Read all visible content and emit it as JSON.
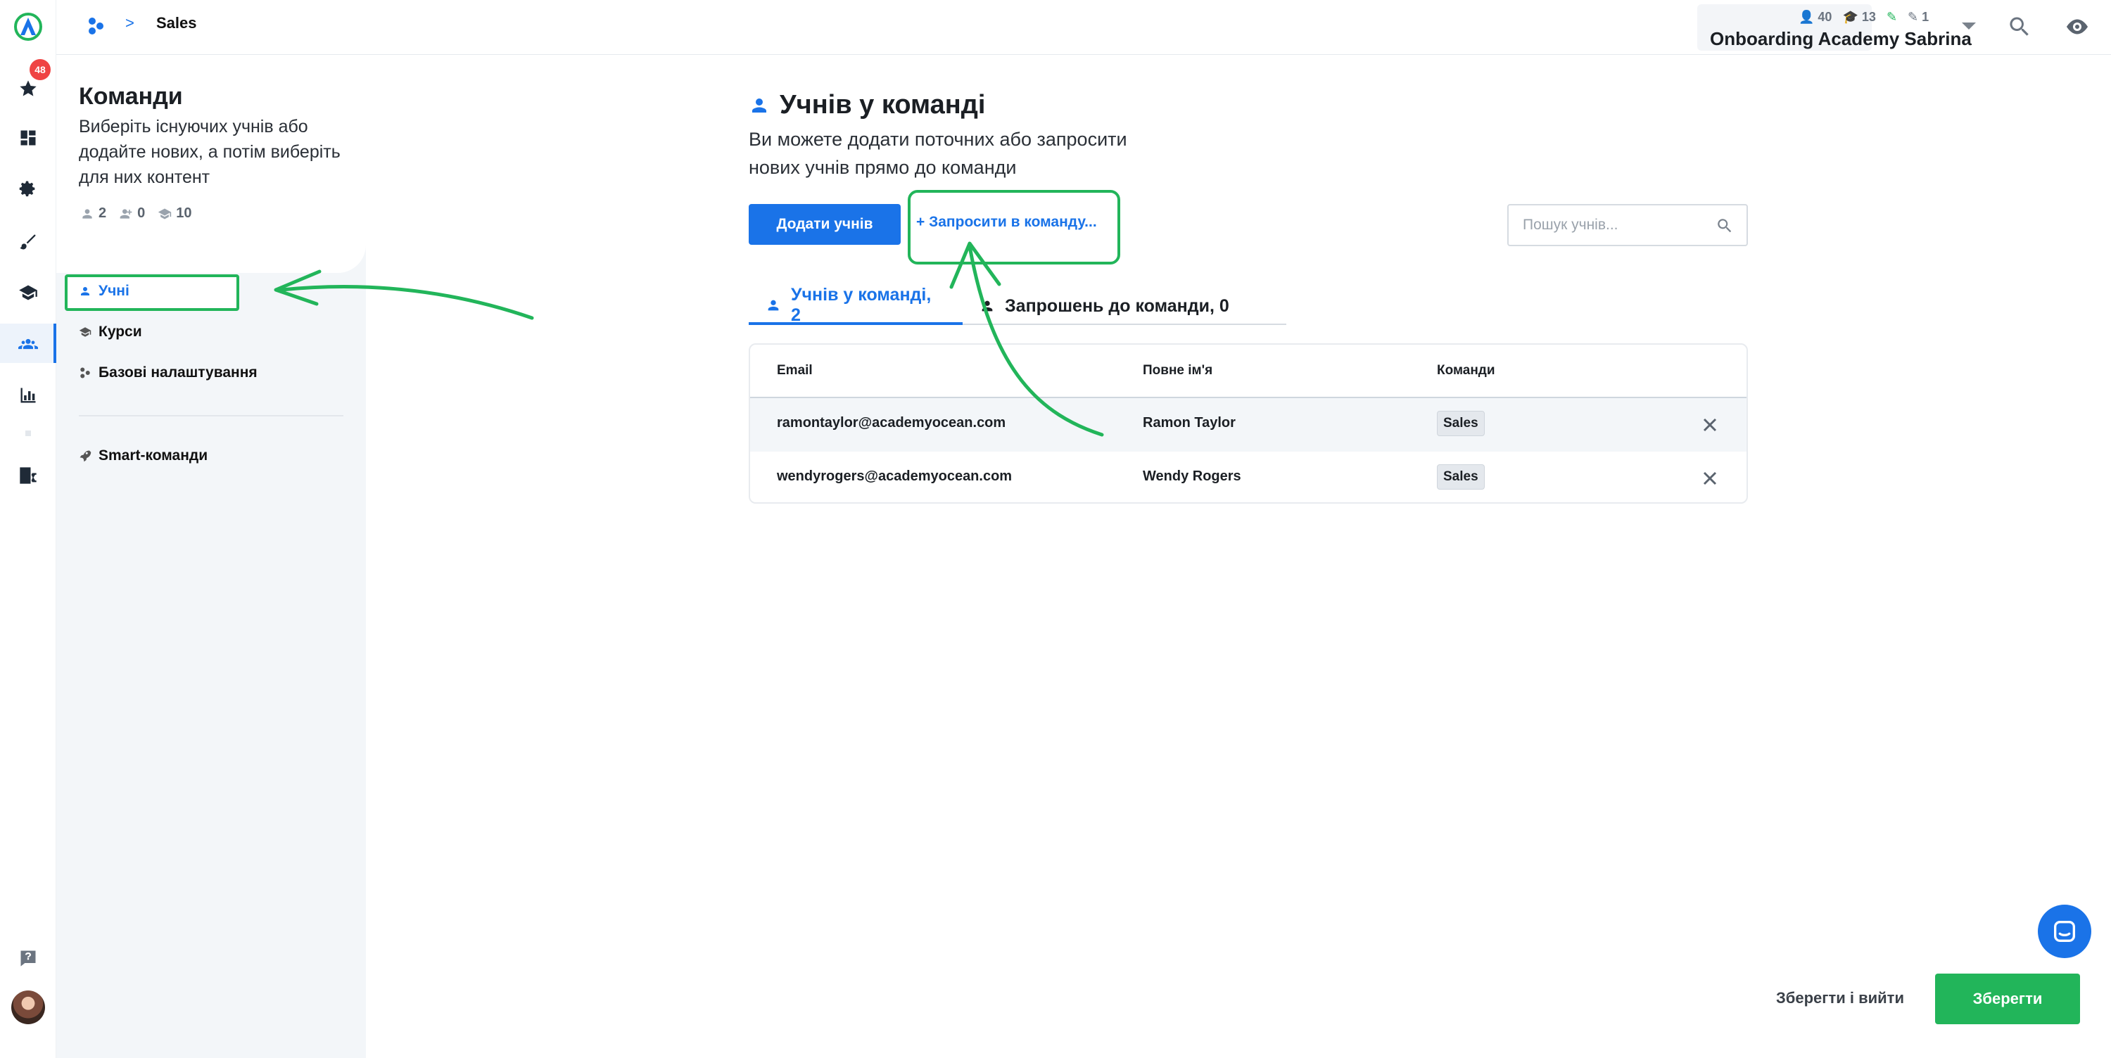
{
  "rail": {
    "badge_count": "48",
    "items": [
      "logo-icon",
      "star-icon",
      "dashboard-icon",
      "gear-icon",
      "brush-icon",
      "graduation-cap-icon",
      "team-icon",
      "bar-chart-icon",
      "translate-icon",
      "help-icon"
    ]
  },
  "topbar": {
    "breadcrumb_separator": ">",
    "breadcrumb_title": "Sales",
    "stats": {
      "learners": "40",
      "courses": "13",
      "third": "",
      "fourth": "1"
    },
    "academy_name": "Onboarding Academy Sabrina"
  },
  "sidebar": {
    "title": "Команди",
    "description": "Виберіть існуючих учнів або додайте нових, а потім виберіть для них контент",
    "stats": {
      "learners": "2",
      "invited": "0",
      "courses": "10"
    },
    "items": [
      {
        "label": "Учні",
        "icon": "user-icon",
        "active": true
      },
      {
        "label": "Курси",
        "icon": "graduation-cap-icon",
        "active": false
      },
      {
        "label": "Базові налаштування",
        "icon": "settings-icon",
        "active": false
      },
      {
        "label": "Smart-команди",
        "icon": "rocket-icon",
        "active": false
      }
    ]
  },
  "main": {
    "title": "Учнів у команді",
    "description": "Ви можете додати поточних або запросити нових учнів прямо до команди",
    "add_button": "Додати учнів",
    "invite_link": "+ Запросити в команду...",
    "search_placeholder": "Пошук учнів...",
    "tabs": [
      {
        "label": "Учнів у команді, 2",
        "active": true
      },
      {
        "label": "Запрошень до команди, 0",
        "active": false
      }
    ],
    "table": {
      "headers": [
        "Email",
        "Повне ім'я",
        "Команди"
      ],
      "rows": [
        {
          "email": "ramontaylor@academyocean.com",
          "name": "Ramon Taylor",
          "team": "Sales"
        },
        {
          "email": "wendyrogers@academyocean.com",
          "name": "Wendy Rogers",
          "team": "Sales"
        }
      ]
    }
  },
  "footer": {
    "save_exit": "Зберегти і вийти",
    "save": "Зберегти"
  },
  "colors": {
    "accent": "#1a73e8",
    "success": "#22b55a",
    "badge": "#ef4444",
    "sidebar_bg": "#f3f6f9",
    "annotation": "#22b55a"
  }
}
